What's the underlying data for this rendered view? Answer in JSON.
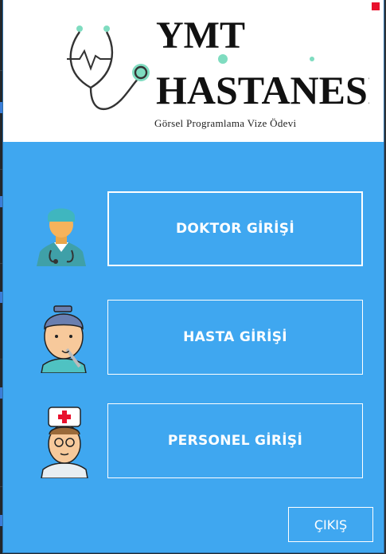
{
  "header": {
    "title_line1": "YMT",
    "title_line2": "HASTANESİ",
    "subtitle": "Görsel Programlama Vize Ödevi"
  },
  "buttons": {
    "doktor": "DOKTOR GİRİŞİ",
    "hasta": "HASTA GİRİŞİ",
    "personel": "PERSONEL GİRİŞİ",
    "exit": "ÇIKIŞ"
  },
  "icons": {
    "logo": "stethoscope-icon",
    "doktor": "doctor-avatar-icon",
    "hasta": "patient-avatar-icon",
    "personel": "nurse-avatar-icon",
    "close": "close-icon"
  },
  "colors": {
    "window_bg": "#3fa7f0",
    "header_bg": "#ffffff",
    "accent_mint": "#7fdcc0",
    "close_red": "#e8112d"
  }
}
